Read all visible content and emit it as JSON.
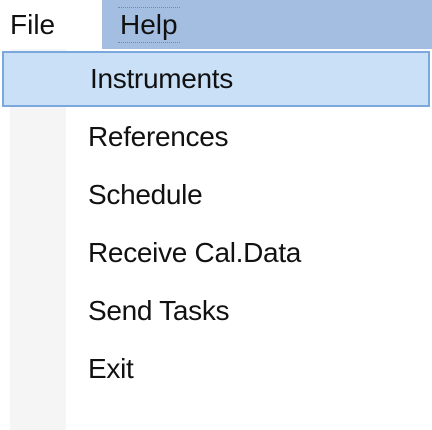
{
  "menubar": {
    "items": [
      {
        "label": "File"
      },
      {
        "label": "Help"
      }
    ]
  },
  "file_menu": {
    "items": [
      {
        "label": "Instruments"
      },
      {
        "label": "References"
      },
      {
        "label": "Schedule"
      },
      {
        "label": "Receive Cal.Data"
      },
      {
        "label": "Send Tasks"
      },
      {
        "label": "Exit"
      }
    ],
    "highlighted_item": "Instruments"
  },
  "colors": {
    "menubar_background": "#a3bee0",
    "highlight_background": "#c9e0f7",
    "highlight_border": "#7aa8dc",
    "gutter": "#f5f5f5"
  }
}
